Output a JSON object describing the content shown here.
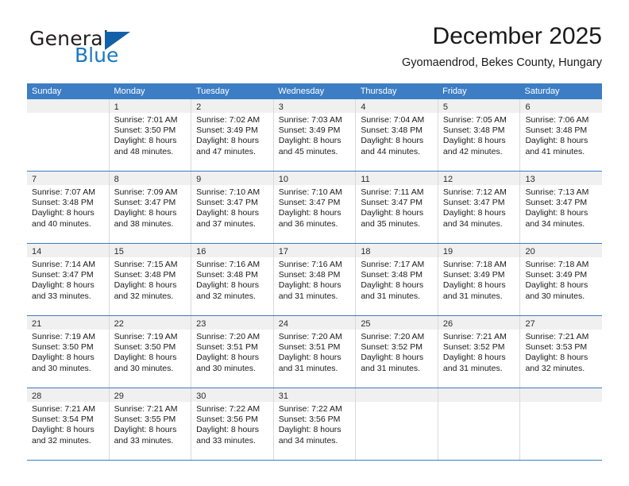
{
  "brand": {
    "name_primary": "General",
    "name_secondary": "Blue",
    "triangle_icon": "triangle-logo-icon",
    "primary_color": "#231f20",
    "secondary_color": "#1a78c2",
    "triangle_color": "#1261a8"
  },
  "header": {
    "month_title": "December 2025",
    "location": "Gyomaendrod, Bekes County, Hungary"
  },
  "calendar": {
    "header_bg": "#3c7dc4",
    "weekdays": [
      "Sunday",
      "Monday",
      "Tuesday",
      "Wednesday",
      "Thursday",
      "Friday",
      "Saturday"
    ],
    "weeks": [
      [
        {
          "day": "",
          "lines": []
        },
        {
          "day": "1",
          "lines": [
            "Sunrise: 7:01 AM",
            "Sunset: 3:50 PM",
            "Daylight: 8 hours",
            "and 48 minutes."
          ]
        },
        {
          "day": "2",
          "lines": [
            "Sunrise: 7:02 AM",
            "Sunset: 3:49 PM",
            "Daylight: 8 hours",
            "and 47 minutes."
          ]
        },
        {
          "day": "3",
          "lines": [
            "Sunrise: 7:03 AM",
            "Sunset: 3:49 PM",
            "Daylight: 8 hours",
            "and 45 minutes."
          ]
        },
        {
          "day": "4",
          "lines": [
            "Sunrise: 7:04 AM",
            "Sunset: 3:48 PM",
            "Daylight: 8 hours",
            "and 44 minutes."
          ]
        },
        {
          "day": "5",
          "lines": [
            "Sunrise: 7:05 AM",
            "Sunset: 3:48 PM",
            "Daylight: 8 hours",
            "and 42 minutes."
          ]
        },
        {
          "day": "6",
          "lines": [
            "Sunrise: 7:06 AM",
            "Sunset: 3:48 PM",
            "Daylight: 8 hours",
            "and 41 minutes."
          ]
        }
      ],
      [
        {
          "day": "7",
          "lines": [
            "Sunrise: 7:07 AM",
            "Sunset: 3:48 PM",
            "Daylight: 8 hours",
            "and 40 minutes."
          ]
        },
        {
          "day": "8",
          "lines": [
            "Sunrise: 7:09 AM",
            "Sunset: 3:47 PM",
            "Daylight: 8 hours",
            "and 38 minutes."
          ]
        },
        {
          "day": "9",
          "lines": [
            "Sunrise: 7:10 AM",
            "Sunset: 3:47 PM",
            "Daylight: 8 hours",
            "and 37 minutes."
          ]
        },
        {
          "day": "10",
          "lines": [
            "Sunrise: 7:10 AM",
            "Sunset: 3:47 PM",
            "Daylight: 8 hours",
            "and 36 minutes."
          ]
        },
        {
          "day": "11",
          "lines": [
            "Sunrise: 7:11 AM",
            "Sunset: 3:47 PM",
            "Daylight: 8 hours",
            "and 35 minutes."
          ]
        },
        {
          "day": "12",
          "lines": [
            "Sunrise: 7:12 AM",
            "Sunset: 3:47 PM",
            "Daylight: 8 hours",
            "and 34 minutes."
          ]
        },
        {
          "day": "13",
          "lines": [
            "Sunrise: 7:13 AM",
            "Sunset: 3:47 PM",
            "Daylight: 8 hours",
            "and 34 minutes."
          ]
        }
      ],
      [
        {
          "day": "14",
          "lines": [
            "Sunrise: 7:14 AM",
            "Sunset: 3:47 PM",
            "Daylight: 8 hours",
            "and 33 minutes."
          ]
        },
        {
          "day": "15",
          "lines": [
            "Sunrise: 7:15 AM",
            "Sunset: 3:48 PM",
            "Daylight: 8 hours",
            "and 32 minutes."
          ]
        },
        {
          "day": "16",
          "lines": [
            "Sunrise: 7:16 AM",
            "Sunset: 3:48 PM",
            "Daylight: 8 hours",
            "and 32 minutes."
          ]
        },
        {
          "day": "17",
          "lines": [
            "Sunrise: 7:16 AM",
            "Sunset: 3:48 PM",
            "Daylight: 8 hours",
            "and 31 minutes."
          ]
        },
        {
          "day": "18",
          "lines": [
            "Sunrise: 7:17 AM",
            "Sunset: 3:48 PM",
            "Daylight: 8 hours",
            "and 31 minutes."
          ]
        },
        {
          "day": "19",
          "lines": [
            "Sunrise: 7:18 AM",
            "Sunset: 3:49 PM",
            "Daylight: 8 hours",
            "and 31 minutes."
          ]
        },
        {
          "day": "20",
          "lines": [
            "Sunrise: 7:18 AM",
            "Sunset: 3:49 PM",
            "Daylight: 8 hours",
            "and 30 minutes."
          ]
        }
      ],
      [
        {
          "day": "21",
          "lines": [
            "Sunrise: 7:19 AM",
            "Sunset: 3:50 PM",
            "Daylight: 8 hours",
            "and 30 minutes."
          ]
        },
        {
          "day": "22",
          "lines": [
            "Sunrise: 7:19 AM",
            "Sunset: 3:50 PM",
            "Daylight: 8 hours",
            "and 30 minutes."
          ]
        },
        {
          "day": "23",
          "lines": [
            "Sunrise: 7:20 AM",
            "Sunset: 3:51 PM",
            "Daylight: 8 hours",
            "and 30 minutes."
          ]
        },
        {
          "day": "24",
          "lines": [
            "Sunrise: 7:20 AM",
            "Sunset: 3:51 PM",
            "Daylight: 8 hours",
            "and 31 minutes."
          ]
        },
        {
          "day": "25",
          "lines": [
            "Sunrise: 7:20 AM",
            "Sunset: 3:52 PM",
            "Daylight: 8 hours",
            "and 31 minutes."
          ]
        },
        {
          "day": "26",
          "lines": [
            "Sunrise: 7:21 AM",
            "Sunset: 3:52 PM",
            "Daylight: 8 hours",
            "and 31 minutes."
          ]
        },
        {
          "day": "27",
          "lines": [
            "Sunrise: 7:21 AM",
            "Sunset: 3:53 PM",
            "Daylight: 8 hours",
            "and 32 minutes."
          ]
        }
      ],
      [
        {
          "day": "28",
          "lines": [
            "Sunrise: 7:21 AM",
            "Sunset: 3:54 PM",
            "Daylight: 8 hours",
            "and 32 minutes."
          ]
        },
        {
          "day": "29",
          "lines": [
            "Sunrise: 7:21 AM",
            "Sunset: 3:55 PM",
            "Daylight: 8 hours",
            "and 33 minutes."
          ]
        },
        {
          "day": "30",
          "lines": [
            "Sunrise: 7:22 AM",
            "Sunset: 3:56 PM",
            "Daylight: 8 hours",
            "and 33 minutes."
          ]
        },
        {
          "day": "31",
          "lines": [
            "Sunrise: 7:22 AM",
            "Sunset: 3:56 PM",
            "Daylight: 8 hours",
            "and 34 minutes."
          ]
        },
        {
          "day": "",
          "lines": []
        },
        {
          "day": "",
          "lines": []
        },
        {
          "day": "",
          "lines": []
        }
      ]
    ]
  }
}
